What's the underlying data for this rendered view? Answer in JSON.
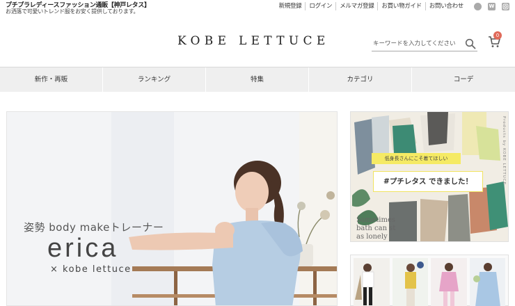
{
  "header": {
    "site_title": "プチプラレディースファッション通販【神戸レタス】",
    "tagline": "お洒落で可愛いトレンド服をお安く提供しております。",
    "utility_links": [
      "新規登録",
      "ログイン",
      "メルマガ登録",
      "お買い物ガイド",
      "お問い合わせ"
    ],
    "social_icons": [
      "line-icon",
      "wear-icon",
      "instagram-icon"
    ],
    "social_glyphs": [
      "",
      "W",
      ""
    ],
    "logo": "KOBE LETTUCE",
    "search": {
      "placeholder": "キーワードを入力してください"
    },
    "cart": {
      "count": "0"
    }
  },
  "nav": {
    "items": [
      "新作・再販",
      "ランキング",
      "特集",
      "カテゴリ",
      "コーデ"
    ]
  },
  "hero": {
    "headline": "姿勢 body makeトレーナー",
    "name": "erica",
    "collab": "× kobe lettuce"
  },
  "banner": {
    "vertical_text": "Products by KOBE LETTUCE",
    "caption": "低身長さんにこそ着てほしい",
    "title": "#プチレタス できました！",
    "script_text": [
      "Sometimes",
      "bath can st",
      "as lonely"
    ]
  },
  "colors": {
    "accent_red": "#e06a5a",
    "banner_yellow": "#f5ea64",
    "nav_bg": "#efefef"
  }
}
